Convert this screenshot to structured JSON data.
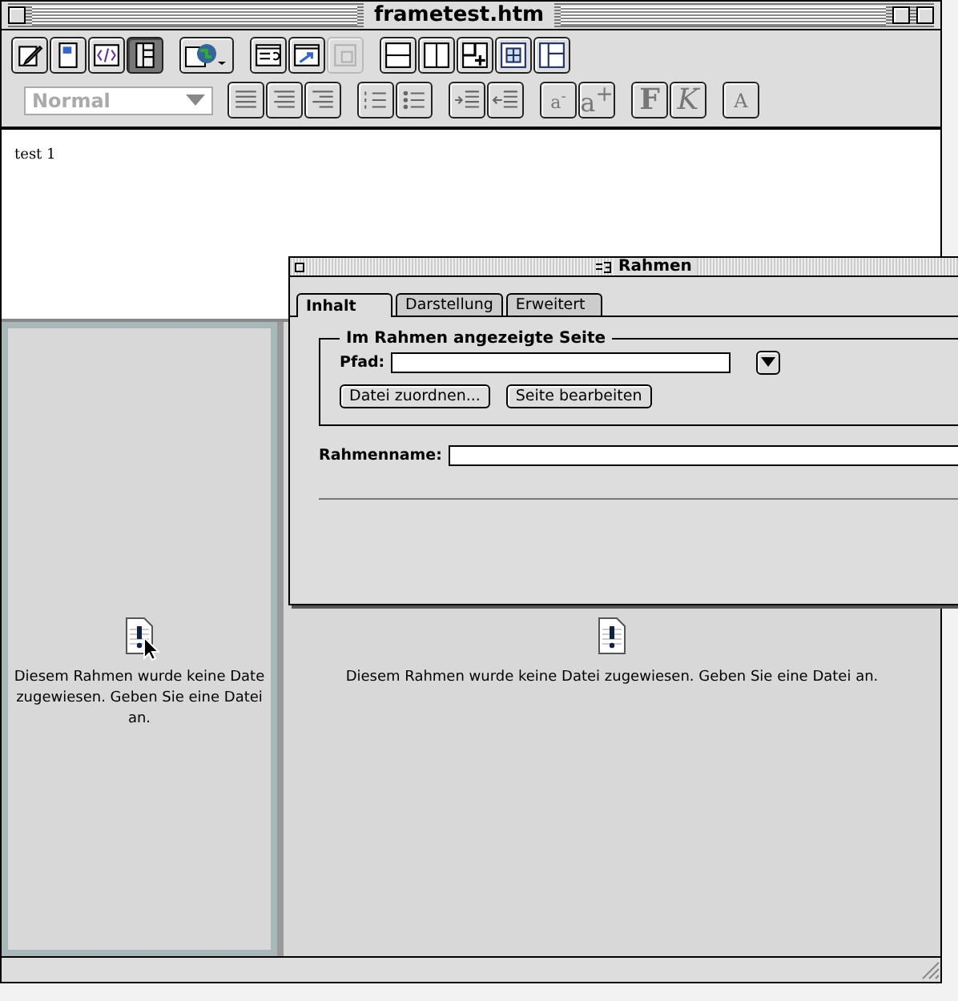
{
  "window": {
    "title": "frametest.htm"
  },
  "toolbar_row1": [
    {
      "kind": "pencil",
      "selected": false,
      "disabled": false
    },
    {
      "kind": "design",
      "selected": false,
      "disabled": false
    },
    {
      "kind": "code",
      "selected": false,
      "disabled": false
    },
    {
      "kind": "frames",
      "selected": true,
      "disabled": false
    },
    {
      "kind": "globe",
      "selected": false,
      "disabled": false
    },
    {
      "kind": "inspector",
      "selected": false,
      "disabled": false
    },
    {
      "kind": "link",
      "selected": false,
      "disabled": false
    },
    {
      "kind": "page",
      "selected": false,
      "disabled": true
    },
    {
      "kind": "split-h",
      "selected": false,
      "disabled": false
    },
    {
      "kind": "split-v",
      "selected": false,
      "disabled": false
    },
    {
      "kind": "add",
      "selected": false,
      "disabled": false
    },
    {
      "kind": "inset",
      "selected": false,
      "disabled": false
    },
    {
      "kind": "side",
      "selected": false,
      "disabled": false
    }
  ],
  "style_select": {
    "value": "Normal",
    "disabled": true
  },
  "toolbar_row2": [
    {
      "kind": "align-left"
    },
    {
      "kind": "align-center"
    },
    {
      "kind": "align-right"
    },
    {
      "kind": "numbered-list"
    },
    {
      "kind": "bullet-list"
    },
    {
      "kind": "indent"
    },
    {
      "kind": "outdent"
    },
    {
      "kind": "smaller",
      "label": "a$^{-}$"
    },
    {
      "kind": "larger",
      "label": "a$^{+}$"
    },
    {
      "kind": "bold",
      "label": "F"
    },
    {
      "kind": "italic",
      "label": "K"
    },
    {
      "kind": "color",
      "label": "A"
    }
  ],
  "top_frame": {
    "text": "test 1"
  },
  "frames": [
    {
      "message": "Diesem Rahmen wurde keine Date zugewiesen. Geben Sie eine Datei an.",
      "selected": true
    },
    {
      "message": "Diesem Rahmen wurde keine Datei zugewiesen. Geben Sie eine Datei an.",
      "selected": false
    }
  ],
  "palette": {
    "title": "Rahmen",
    "tabs": [
      {
        "label": "Inhalt",
        "selected": true
      },
      {
        "label": "Darstellung",
        "selected": false
      },
      {
        "label": "Erweitert",
        "selected": false
      }
    ],
    "group_title": "Im Rahmen angezeigte Seite",
    "path_label": "Pfad:",
    "buttons": [
      "Datei zuordnen...",
      "Seite bearbeiten"
    ],
    "name_label": "Rahmenname:"
  }
}
